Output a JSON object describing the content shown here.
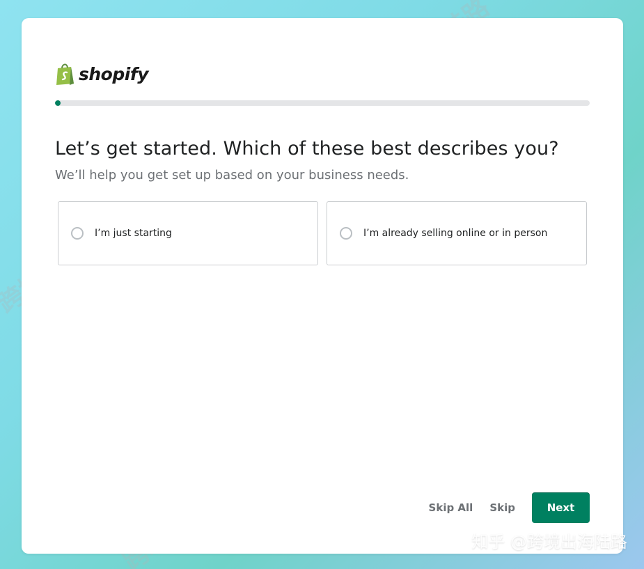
{
  "brand": {
    "name": "shopify",
    "color": "#95bf47",
    "accent": "#008060"
  },
  "progress": {
    "percent": 1
  },
  "main": {
    "title": "Let’s get started. Which of these best describes you?",
    "subtitle": "We’ll help you get set up based on your business needs.",
    "options": [
      {
        "label": "I’m just starting"
      },
      {
        "label": "I’m already selling online or in person"
      }
    ]
  },
  "footer": {
    "skip_all": "Skip All",
    "skip": "Skip",
    "next": "Next"
  },
  "watermark": {
    "text": "跨境出海陆路",
    "credit": "知乎 @跨境出海陆路"
  }
}
